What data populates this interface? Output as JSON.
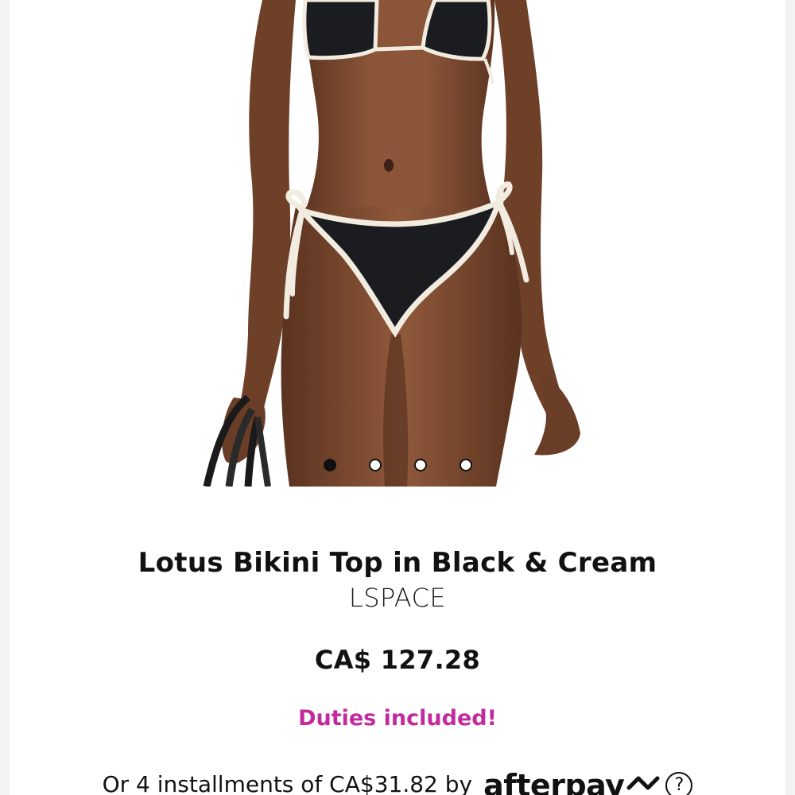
{
  "product": {
    "title": "Lotus Bikini Top in Black & Cream",
    "brand": "LSPACE",
    "price": "CA$ 127.28",
    "duties_note": "Duties included!",
    "installments_text": "Or 4 installments of CA$31.82 by",
    "installments_provider": "afterpay",
    "help_glyph": "?"
  },
  "gallery": {
    "image_count": 4,
    "active_index": 0
  },
  "colors": {
    "duties": "#c22a9e",
    "text": "#111111",
    "skin": "#7a4a31",
    "swimsuit": "#1b1c20",
    "trim": "#f2ece0"
  }
}
